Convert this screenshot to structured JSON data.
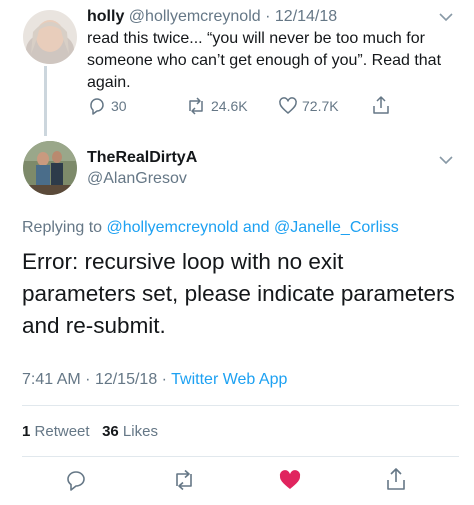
{
  "tweet1": {
    "display_name": "holly",
    "handle": "@hollyemcreynold",
    "separator": "·",
    "date": "12/14/18",
    "text": "read this twice... “you will never be too much for someone who can’t get enough of you”. Read that again.",
    "replies": "30",
    "retweets": "24.6K",
    "likes": "72.7K"
  },
  "tweet2": {
    "display_name": "TheRealDirtyA",
    "handle": "@AlanGresov",
    "replying_prefix": "Replying to",
    "replying_user1": "@hollyemcreynold",
    "replying_and": "and",
    "replying_user2": "@Janelle_Corliss",
    "text": "Error: recursive loop with no exit parameters set, please indicate parameters and re-submit.",
    "time": "7:41 AM",
    "meta_sep1": "·",
    "date": "12/15/18",
    "meta_sep2": "·",
    "source": "Twitter Web App",
    "retweet_count": "1",
    "retweet_label": "Retweet",
    "like_count": "36",
    "like_label": "Likes"
  },
  "colors": {
    "link": "#1da1f2",
    "secondary": "#657786",
    "like_active": "#e0245e",
    "divider": "#e1e8ed"
  }
}
